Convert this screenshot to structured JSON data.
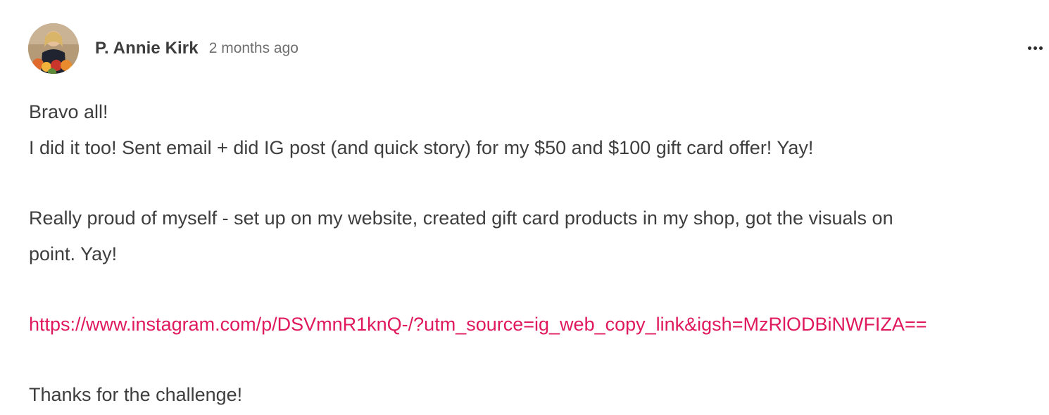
{
  "post": {
    "author": "P. Annie Kirk",
    "timestamp": "2 months ago",
    "more_icon": "more-horizontal-icon",
    "lines": {
      "line1": "Bravo all!",
      "line2": "I did it too! Sent email + did IG post (and quick story) for my $50 and $100 gift card offer! Yay!",
      "line3": "Really proud of myself - set up on my website, created gift card products in my shop, got the visuals on",
      "line4": "point. Yay!",
      "link": "https://www.instagram.com/p/DSVmnR1knQ-/?utm_source=ig_web_copy_link&igsh=MzRlODBiNWFIZA==",
      "line6": "Thanks for the challenge!"
    },
    "colors": {
      "link": "#e0195e",
      "text": "#3e3e3e",
      "muted": "#6f6f6f"
    }
  }
}
